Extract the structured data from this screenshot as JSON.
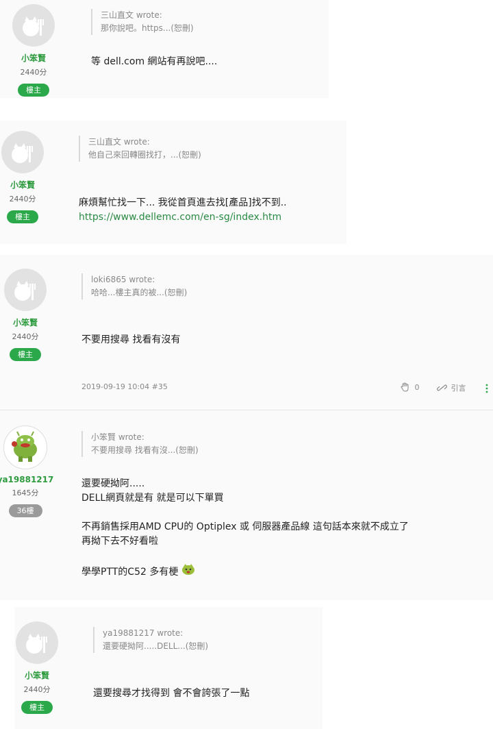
{
  "posts": [
    {
      "user": {
        "name": "小笨賢",
        "score": "2440分",
        "badge": "樓主"
      },
      "quote": {
        "author": "三山直文 wrote:",
        "text": "那你說吧。https...(恕刪)"
      },
      "body": [
        "等 dell.com 網站有再說吧...."
      ]
    },
    {
      "user": {
        "name": "小笨賢",
        "score": "2440分",
        "badge": "樓主"
      },
      "quote": {
        "author": "三山直文 wrote:",
        "text": "他自己來回轉圈找打，...(恕刪)"
      },
      "body": [
        "麻煩幫忙找一下... 我從首頁進去找[產品]找不到.."
      ],
      "link": "https://www.dellemc.com/en-sg/index.htm"
    },
    {
      "user": {
        "name": "小笨賢",
        "score": "2440分",
        "badge": "樓主"
      },
      "quote": {
        "author": "loki6865 wrote:",
        "text": "哈哈...樓主真的被...(恕刪)"
      },
      "body": [
        "不要用搜尋 找看有沒有"
      ],
      "meta": {
        "datetime": "2019-09-19 10:04",
        "floor": "#35",
        "likes": "0",
        "quote_label": "引言"
      }
    },
    {
      "user": {
        "name": "ya19881217",
        "score": "1645分",
        "badge": "36樓"
      },
      "quote": {
        "author": "小笨賢 wrote:",
        "text": "不要用搜尋 找看有沒...(恕刪)"
      },
      "body": [
        "還要硬拗阿.....",
        "DELL網頁就是有 就是可以下單買",
        "不再銷售採用AMD CPU的 Optiplex 或 伺服器產品線 這句話本來就不成立了",
        "再拗下去不好看啦",
        "學學PTT的C52 多有梗"
      ]
    },
    {
      "user": {
        "name": "小笨賢",
        "score": "2440分",
        "badge": "樓主"
      },
      "quote": {
        "author": "ya19881217 wrote:",
        "text": "還要硬拗阿.....DELL...(恕刪)"
      },
      "body": [
        "還要搜尋才找得到 會不會誇張了一點"
      ]
    }
  ],
  "colors": {
    "accent": "#2aa84a",
    "username": "#2e9b3f",
    "badge_gray": "#9a9a9a"
  },
  "icons": [
    "user-avatar-icon",
    "android-avatar-icon",
    "like-hand-icon",
    "quote-link-icon",
    "more-vertical-icon",
    "emoji-icon"
  ]
}
